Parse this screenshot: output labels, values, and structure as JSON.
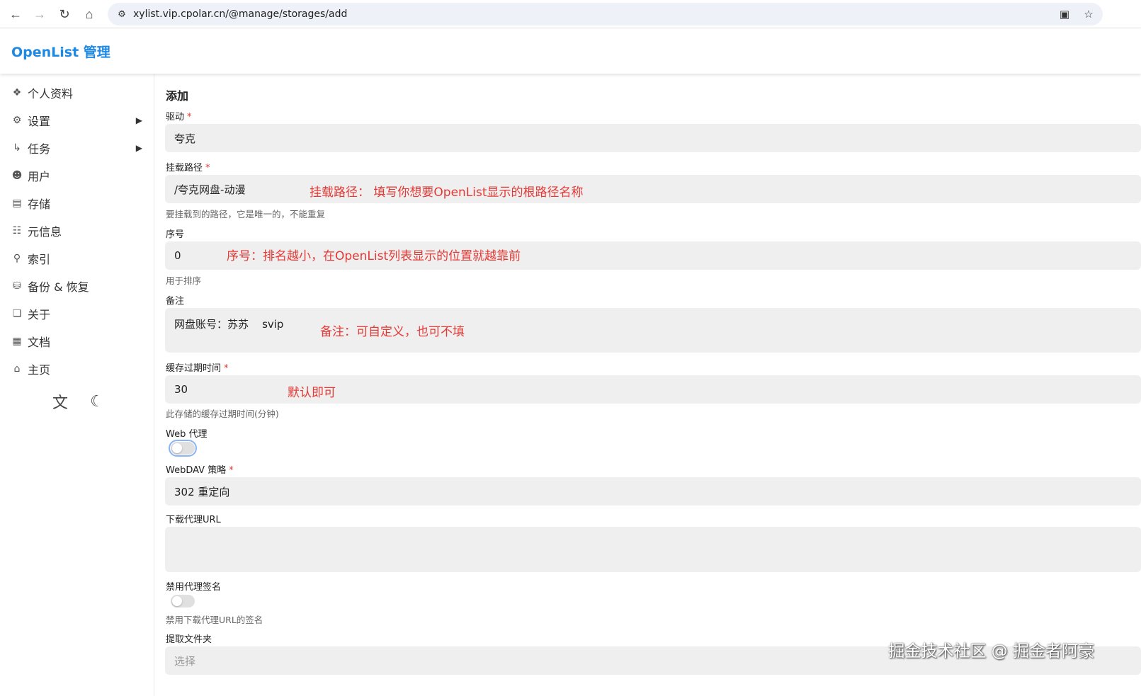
{
  "browser": {
    "url": "xylist.vip.cpolar.cn/@manage/storages/add",
    "icons": {
      "back": "back-arrow-icon",
      "forward": "forward-arrow-icon",
      "reload": "reload-icon",
      "home": "home-icon",
      "site": "site-settings-icon",
      "install": "install-app-icon",
      "bookmark": "star-icon"
    }
  },
  "app": {
    "title": "OpenList 管理"
  },
  "sidebar": {
    "items": [
      {
        "label": "个人资料",
        "icon": "fingerprint-icon"
      },
      {
        "label": "设置",
        "icon": "gear-icon",
        "has_children": true
      },
      {
        "label": "任务",
        "icon": "route-icon",
        "has_children": true
      },
      {
        "label": "用户",
        "icon": "user-circle-icon"
      },
      {
        "label": "存储",
        "icon": "storage-icon"
      },
      {
        "label": "元信息",
        "icon": "meta-icon"
      },
      {
        "label": "索引",
        "icon": "search-icon"
      },
      {
        "label": "备份 & 恢复",
        "icon": "database-icon"
      },
      {
        "label": "关于",
        "icon": "copy-icon"
      },
      {
        "label": "文档",
        "icon": "book-icon"
      },
      {
        "label": "主页",
        "icon": "home-icon"
      }
    ],
    "bottom_icons": [
      "translate-icon",
      "moon-icon"
    ]
  },
  "form": {
    "heading": "添加",
    "driver": {
      "label": "驱动",
      "value": "夸克"
    },
    "mount_path": {
      "label": "挂载路径",
      "value": "/夸克网盘-动漫",
      "help": "要挂载到的路径，它是唯一的，不能重复",
      "note": "挂载路径：  填写你想要OpenList显示的根路径名称"
    },
    "order": {
      "label": "序号",
      "value": "0",
      "help": "用于排序",
      "note": "序号：排名越小，在OpenList列表显示的位置就越靠前"
    },
    "remark": {
      "label": "备注",
      "value": "网盘账号：苏苏    svip",
      "note": "备注：可自定义，也可不填"
    },
    "cache_expiration": {
      "label": "缓存过期时间",
      "value": "30",
      "help": "此存储的缓存过期时间(分钟)",
      "note": "默认即可"
    },
    "web_proxy": {
      "label": "Web 代理",
      "on": false
    },
    "webdav_policy": {
      "label": "WebDAV 策略",
      "value": "302 重定向"
    },
    "download_proxy_url": {
      "label": "下载代理URL",
      "value": ""
    },
    "disable_proxy_sign": {
      "label": "禁用代理签名",
      "help": "禁用下载代理URL的签名",
      "on": false
    },
    "extract_folder": {
      "label": "提取文件夹",
      "placeholder": "选择"
    }
  },
  "watermark": "掘金技术社区 @ 掘金者阿豪",
  "colors": {
    "brand": "#1e88e5",
    "required": "#e53935",
    "annotation": "#e53935",
    "field_bg": "#efefef"
  }
}
